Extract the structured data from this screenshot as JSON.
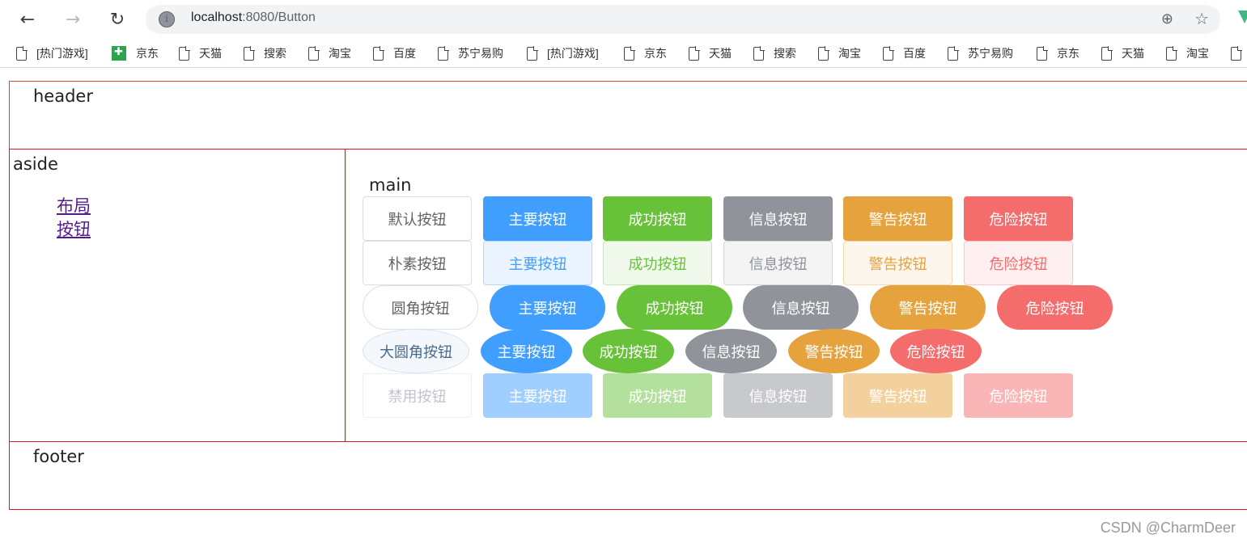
{
  "browser": {
    "url_host": "localhost",
    "url_port_path": ":8080/Button",
    "bookmarks": [
      "[热门游戏]",
      "京东",
      "天猫",
      "搜索",
      "淘宝",
      "百度",
      "苏宁易购",
      "[热门游戏]",
      "京东",
      "天猫",
      "搜索",
      "淘宝",
      "百度",
      "苏宁易购",
      "京东",
      "天猫",
      "淘宝"
    ]
  },
  "layout": {
    "header": "header",
    "aside": "aside",
    "main": "main",
    "footer": "footer",
    "nav_links": [
      "布局",
      "按钮"
    ]
  },
  "buttons": {
    "row1": [
      "默认按钮",
      "主要按钮",
      "成功按钮",
      "信息按钮",
      "警告按钮",
      "危险按钮"
    ],
    "row2": [
      "朴素按钮",
      "主要按钮",
      "成功按钮",
      "信息按钮",
      "警告按钮",
      "危险按钮"
    ],
    "row3": [
      "圆角按钮",
      "主要按钮",
      "成功按钮",
      "信息按钮",
      "警告按钮",
      "危险按钮"
    ],
    "row4": [
      "大圆角按钮",
      "主要按钮",
      "成功按钮",
      "信息按钮",
      "警告按钮",
      "危险按钮"
    ],
    "row5": [
      "禁用按钮",
      "主要按钮",
      "成功按钮",
      "信息按钮",
      "警告按钮",
      "危险按钮"
    ]
  },
  "colors": {
    "primary": "#409eff",
    "success": "#67c23a",
    "info": "#909399",
    "warning": "#e6a23c",
    "danger": "#f56c6c"
  },
  "watermark": "CSDN @CharmDeer"
}
